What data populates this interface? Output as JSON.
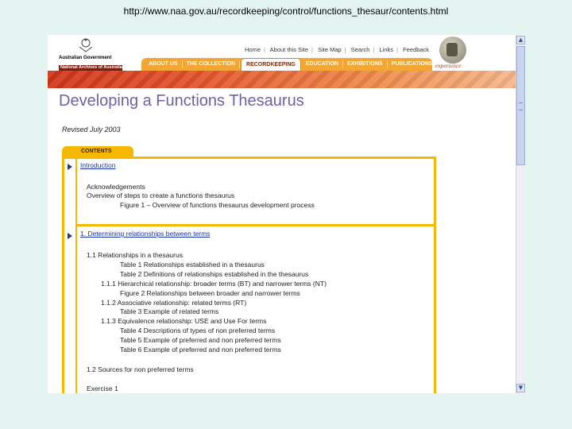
{
  "url": "http://www.naa.gov.au/recordkeeping/control/functions_thesaur/contents.html",
  "header": {
    "logo_line1": "Australian Government",
    "logo_line2": "National Archives of Australia",
    "toplinks": [
      "Home",
      "About this Site",
      "Site Map",
      "Search",
      "Links",
      "Feedback"
    ],
    "nav": [
      "ABOUT US",
      "THE COLLECTION",
      "RECORDKEEPING",
      "EDUCATION",
      "EXHIBITIONS",
      "PUBLICATIONS"
    ],
    "brand": "experience"
  },
  "title": "Developing a Functions Thesaurus",
  "revised": "Revised July 2003",
  "contents": {
    "tab": "CONTENTS",
    "section1": {
      "heading": "Introduction",
      "items": [
        "Acknowledgements",
        "Overview of steps to create a functions thesaurus",
        "Figure 1 – Overview of functions thesaurus development process"
      ]
    },
    "section2": {
      "heading": "1. Determining relationships between terms",
      "items": [
        "1.1 Relationships in a thesaurus",
        "Table 1    Relationships established in a thesaurus",
        "Table 2    Definitions of relationships established in the thesaurus",
        "1.1.1 Hierarchical relationship: broader terms (BT) and narrower terms (NT)",
        "Figure 2    Relationships between broader and narrower terms",
        "1.1.2 Associative relationship: related terms (RT)",
        "Table 3    Example of related terms",
        "1.1.3 Equivalence relationship: USE and Use For terms",
        "Table 4    Descriptions of types of non preferred terms",
        "Table 5    Example of preferred and non preferred terms",
        "Table 6    Example of preferred and non preferred terms",
        "1.2 Sources for non preferred terms",
        "Exercise 1"
      ]
    }
  },
  "colors": {
    "accent": "#f5b800",
    "title": "#6a63a8",
    "link": "#1a33b0",
    "nav": "#f3a633"
  }
}
